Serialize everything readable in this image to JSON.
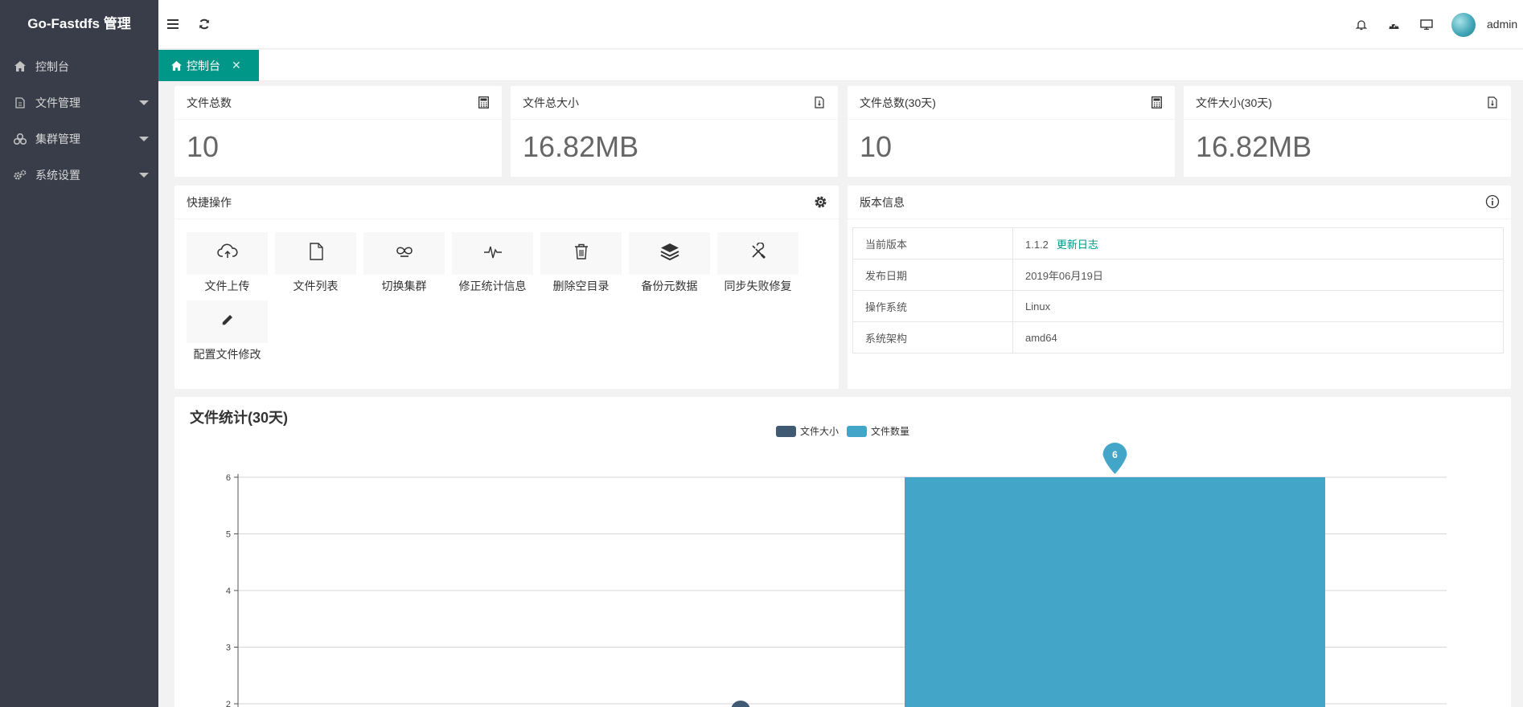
{
  "app": {
    "title": "Go-Fastdfs 管理"
  },
  "sidebar": {
    "items": [
      {
        "label": "控制台",
        "icon": "home-icon",
        "has_caret": false
      },
      {
        "label": "文件管理",
        "icon": "file-icon",
        "has_caret": true
      },
      {
        "label": "集群管理",
        "icon": "cluster-icon",
        "has_caret": true
      },
      {
        "label": "系统设置",
        "icon": "gears-icon",
        "has_caret": true
      }
    ]
  },
  "header": {
    "user": "admin"
  },
  "tabs": [
    {
      "label": "控制台",
      "close": "✕"
    }
  ],
  "stats": [
    {
      "label": "文件总数",
      "value": "10",
      "icon": "calculator-icon"
    },
    {
      "label": "文件总大小",
      "value": "16.82MB",
      "icon": "file-size-icon"
    },
    {
      "label": "文件总数(30天)",
      "value": "10",
      "icon": "calculator-icon"
    },
    {
      "label": "文件大小(30天)",
      "value": "16.82MB",
      "icon": "file-size-icon"
    }
  ],
  "quick_actions": {
    "title": "快捷操作",
    "items": [
      {
        "label": "文件上传",
        "icon": "cloud-upload-icon"
      },
      {
        "label": "文件列表",
        "icon": "file-icon"
      },
      {
        "label": "切换集群",
        "icon": "switch-icon"
      },
      {
        "label": "修正统计信息",
        "icon": "pulse-icon"
      },
      {
        "label": "删除空目录",
        "icon": "trash-icon"
      },
      {
        "label": "备份元数据",
        "icon": "layers-icon"
      },
      {
        "label": "同步失败修复",
        "icon": "tools-icon"
      },
      {
        "label": "配置文件修改",
        "icon": "pencil-icon"
      }
    ]
  },
  "version": {
    "title": "版本信息",
    "rows": [
      {
        "key": "当前版本",
        "value": "1.1.2",
        "link": "更新日志"
      },
      {
        "key": "发布日期",
        "value": "2019年06月19日"
      },
      {
        "key": "操作系统",
        "value": "Linux"
      },
      {
        "key": "系统架构",
        "value": "amd64"
      }
    ]
  },
  "colors": {
    "sidebar": "#393d49",
    "accent": "#009688",
    "size_series": "#415a74",
    "count_series": "#43a6c9"
  },
  "chart_data": {
    "type": "bar",
    "title": "文件统计(30天)",
    "series": [
      {
        "name": "文件大小",
        "color": "#415a74",
        "values": [
          2
        ]
      },
      {
        "name": "文件数量",
        "color": "#43a6c9",
        "values": [
          6
        ]
      }
    ],
    "peak_label": "6",
    "ylim": [
      2,
      6
    ],
    "yticks": [
      "6",
      "5",
      "4",
      "3",
      "2"
    ],
    "grid": true,
    "legend": "top-center"
  }
}
